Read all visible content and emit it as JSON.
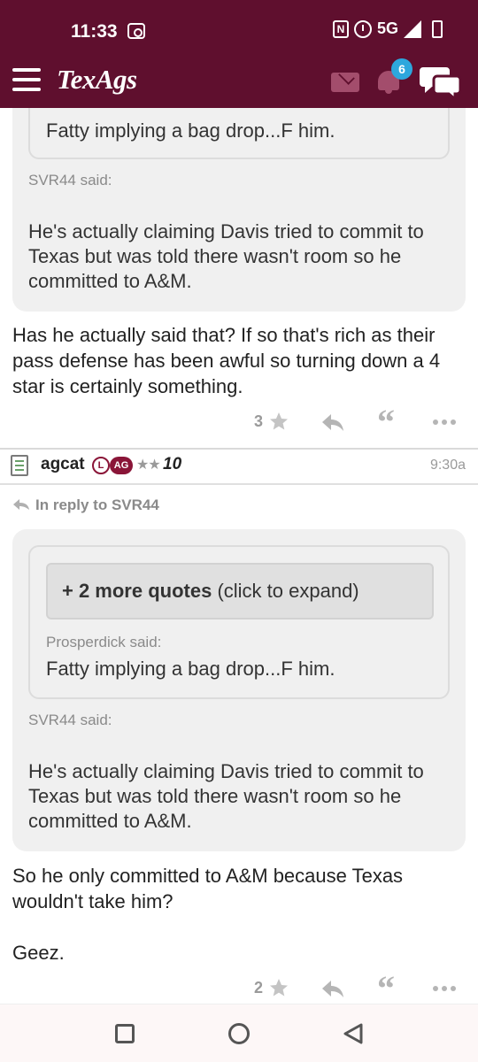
{
  "status_bar": {
    "time": "11:33",
    "network": "5G"
  },
  "app": {
    "logo": "TexAgs",
    "notification_count": "6"
  },
  "post1": {
    "quote_tail": "Fatty implying a bag drop...F him.",
    "quote_author": "SVR44 said:",
    "quote_text": "He's actually claiming Davis tried to commit to Texas but was told there wasn't room so he committed to A&M.",
    "body": "Has he actually said that? If so that's rich as their pass defense has been awful so turning down a 4 star is certainly something.",
    "rating": "3"
  },
  "post2": {
    "username": "agcat",
    "tag_l": "L",
    "tag_ag": "AG",
    "stars": "★★",
    "rank": "10",
    "time": "9:30a",
    "reply_to": "In reply to SVR44",
    "more_quotes_bold": "+ 2 more quotes",
    "more_quotes_rest": " (click to expand)",
    "inner_author": "Prosperdick said:",
    "inner_text": "Fatty implying a bag drop...F him.",
    "quote_author": "SVR44 said:",
    "quote_text": "He's actually claiming Davis tried to commit to Texas but was told there wasn't room so he committed to A&M.",
    "body_line1": "So he only committed to A&M because Texas wouldn't take him?",
    "body_line2": "Geez.",
    "rating": "2"
  }
}
